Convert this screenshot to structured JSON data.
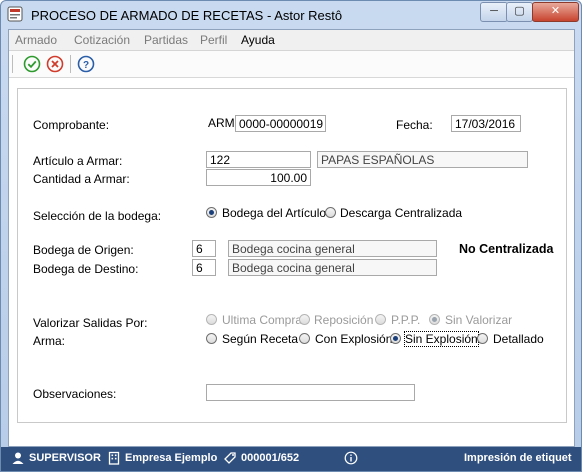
{
  "window": {
    "title": "PROCESO DE ARMADO DE RECETAS - Astor Restô",
    "min_label": "─",
    "max_label": "▢",
    "close_label": "✕"
  },
  "menu": {
    "items": [
      {
        "label": "Armado"
      },
      {
        "label": "Cotización"
      },
      {
        "label": "Partidas"
      },
      {
        "label": "Perfil"
      },
      {
        "label": "Ayuda"
      }
    ]
  },
  "toolbar": {
    "buttons": [
      {
        "icon": "check-icon",
        "color": "#2e9a2e"
      },
      {
        "icon": "cancel-icon",
        "color": "#d13b2b"
      },
      {
        "icon": "help-icon",
        "color": "#2a5ea8"
      }
    ]
  },
  "form": {
    "comprobante_label": "Comprobante:",
    "comprobante_prefix": "ARM",
    "comprobante_number": "0000-00000019",
    "fecha_label": "Fecha:",
    "fecha_value": "17/03/2016",
    "articulo_label": "Artículo a Armar:",
    "articulo_code": "122",
    "articulo_desc": "PAPAS ESPAÑOLAS",
    "cantidad_label": "Cantidad a Armar:",
    "cantidad_value": "100.00",
    "bodega_sel_label": "Selección de la bodega:",
    "bodega_options": [
      {
        "label": "Bodega del Artículo",
        "selected": true
      },
      {
        "label": "Descarga Centralizada",
        "selected": false
      }
    ],
    "origen_label": "Bodega de Origen:",
    "origen_code": "6",
    "origen_desc": "Bodega cocina general",
    "destino_label": "Bodega de Destino:",
    "destino_code": "6",
    "destino_desc": "Bodega cocina general",
    "centralizada_text": "No Centralizada",
    "valorizar_label": "Valorizar Salidas Por:",
    "valorizar_options": [
      {
        "label": "Ultima Compra",
        "selected": false
      },
      {
        "label": "Reposición",
        "selected": false
      },
      {
        "label": "P.P.P.",
        "selected": false
      },
      {
        "label": "Sin Valorizar",
        "selected": true
      }
    ],
    "arma_label": "Arma:",
    "arma_options": [
      {
        "label": "Según Receta",
        "selected": false
      },
      {
        "label": "Con Explosión",
        "selected": false
      },
      {
        "label": "Sin Explosión",
        "selected": true
      },
      {
        "label": "Detallado",
        "selected": false
      }
    ],
    "observaciones_label": "Observaciones:",
    "observaciones_value": ""
  },
  "statusbar": {
    "user": "SUPERVISOR",
    "company": "Empresa Ejemplo",
    "record": "000001/652",
    "message": "Impresión de etiquet"
  }
}
